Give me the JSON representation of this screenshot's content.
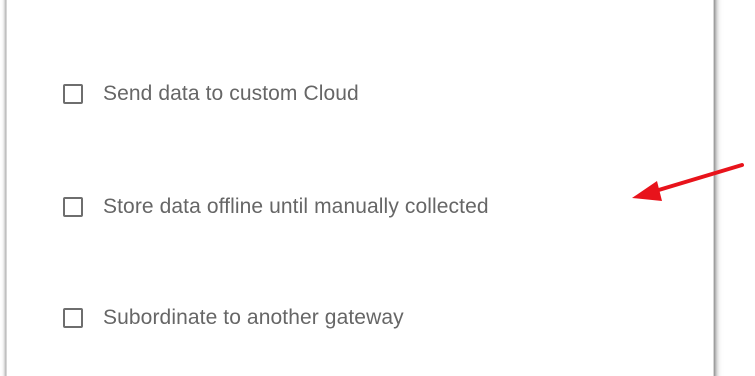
{
  "options": [
    {
      "label": "Send data to custom Cloud",
      "checked": false
    },
    {
      "label": "Store data offline until manually collected",
      "checked": false
    },
    {
      "label": "Subordinate to another gateway",
      "checked": false
    }
  ],
  "colors": {
    "annotation_arrow": "#e8131b",
    "checkbox_border": "#6e6e6e",
    "label_text": "#666666"
  }
}
